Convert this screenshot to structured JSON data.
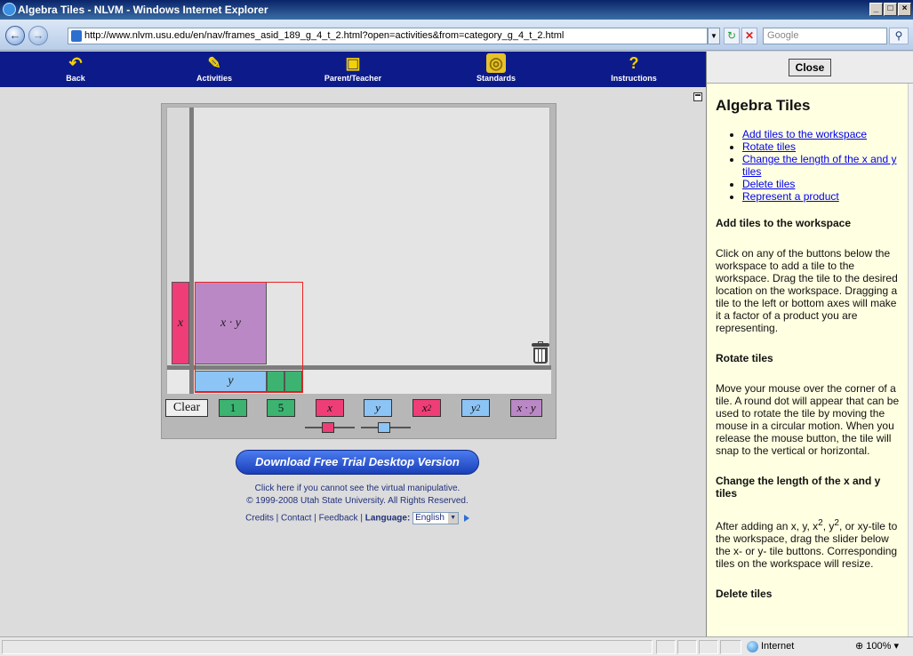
{
  "window": {
    "title": "Algebra Tiles - NLVM - Windows Internet Explorer",
    "minimize": "_",
    "maximize": "□",
    "close": "×"
  },
  "address": {
    "url": "http://www.nlvm.usu.edu/en/nav/frames_asid_189_g_4_t_2.html?open=activities&from=category_g_4_t_2.html",
    "search_placeholder": "Google",
    "back_glyph": "←",
    "forward_glyph": "→",
    "refresh_glyph": "↻",
    "stop_glyph": "✕",
    "search_glyph": "⚲"
  },
  "nav": {
    "items": [
      {
        "label": "Back",
        "icon": "back-arrow-icon",
        "glyph": "↶"
      },
      {
        "label": "Activities",
        "icon": "activities-icon",
        "glyph": "✎"
      },
      {
        "label": "Parent/Teacher",
        "icon": "parent-teacher-icon",
        "glyph": "▣"
      },
      {
        "label": "Standards",
        "icon": "standards-icon",
        "glyph": "◎"
      },
      {
        "label": "Instructions",
        "icon": "instructions-icon",
        "glyph": "?"
      }
    ]
  },
  "workspace": {
    "tiles": {
      "x_tile": "x",
      "xy_tile": "x · y",
      "y_tile": "y"
    }
  },
  "toolbar": {
    "clear": "Clear",
    "one": "1",
    "five": "5",
    "x": "x",
    "y": "y",
    "x2": "x",
    "x2_sup": "2",
    "y2": "y",
    "y2_sup": "2",
    "xy": "x · y"
  },
  "sliders": {
    "x_slider_level": 0.45,
    "y_slider_level": 0.45
  },
  "colors": {
    "nav_bg": "#0d1b8a",
    "green_tile": "#3cb371",
    "pink_tile": "#ee3d77",
    "blue_tile": "#8cc4f5",
    "purple_tile": "#bb88c6",
    "instructions_bg": "#ffffe1"
  },
  "below": {
    "download": "Download Free Trial Desktop Version",
    "cant_see": "Click here if you cannot see the virtual manipulative.",
    "copyright": "© 1999-2008 Utah State University. All Rights Reserved.",
    "credits": "Credits",
    "contact": "Contact",
    "feedback": "Feedback",
    "sep": "|",
    "language_label": "Language:",
    "language_value": "English"
  },
  "instructions": {
    "close": "Close",
    "title": "Algebra Tiles",
    "links": [
      "Add tiles to the workspace",
      "Rotate tiles",
      "Change the length of the x and y tiles",
      "Delete tiles",
      "Represent a product"
    ],
    "sections": [
      {
        "heading": "Add tiles to the workspace",
        "text": "Click on any of the buttons below the workspace to add a tile to the workspace. Drag the tile to the desired location on the workspace. Dragging a tile to the left or bottom axes will make it a factor of a product you are representing."
      },
      {
        "heading": "Rotate tiles",
        "text": "Move your mouse over the corner of a tile. A round dot will appear that can be used to rotate the tile by moving the mouse in a circular motion. When you release the mouse button, the tile will snap to the vertical or horizontal."
      },
      {
        "heading": "Change the length of the x and y tiles",
        "text_a": "After adding an x, y, x",
        "sup1": "2",
        "text_b": ", y",
        "sup2": "2",
        "text_c": ", or xy-tile to the workspace, drag the slider below the x- or y- tile buttons. Corresponding tiles on the workspace will resize."
      },
      {
        "heading": "Delete tiles",
        "text": ""
      }
    ]
  },
  "status": {
    "zone": "Internet",
    "zoom": "100%",
    "zoom_glyph": "⊕",
    "zoom_dd": "▾"
  }
}
